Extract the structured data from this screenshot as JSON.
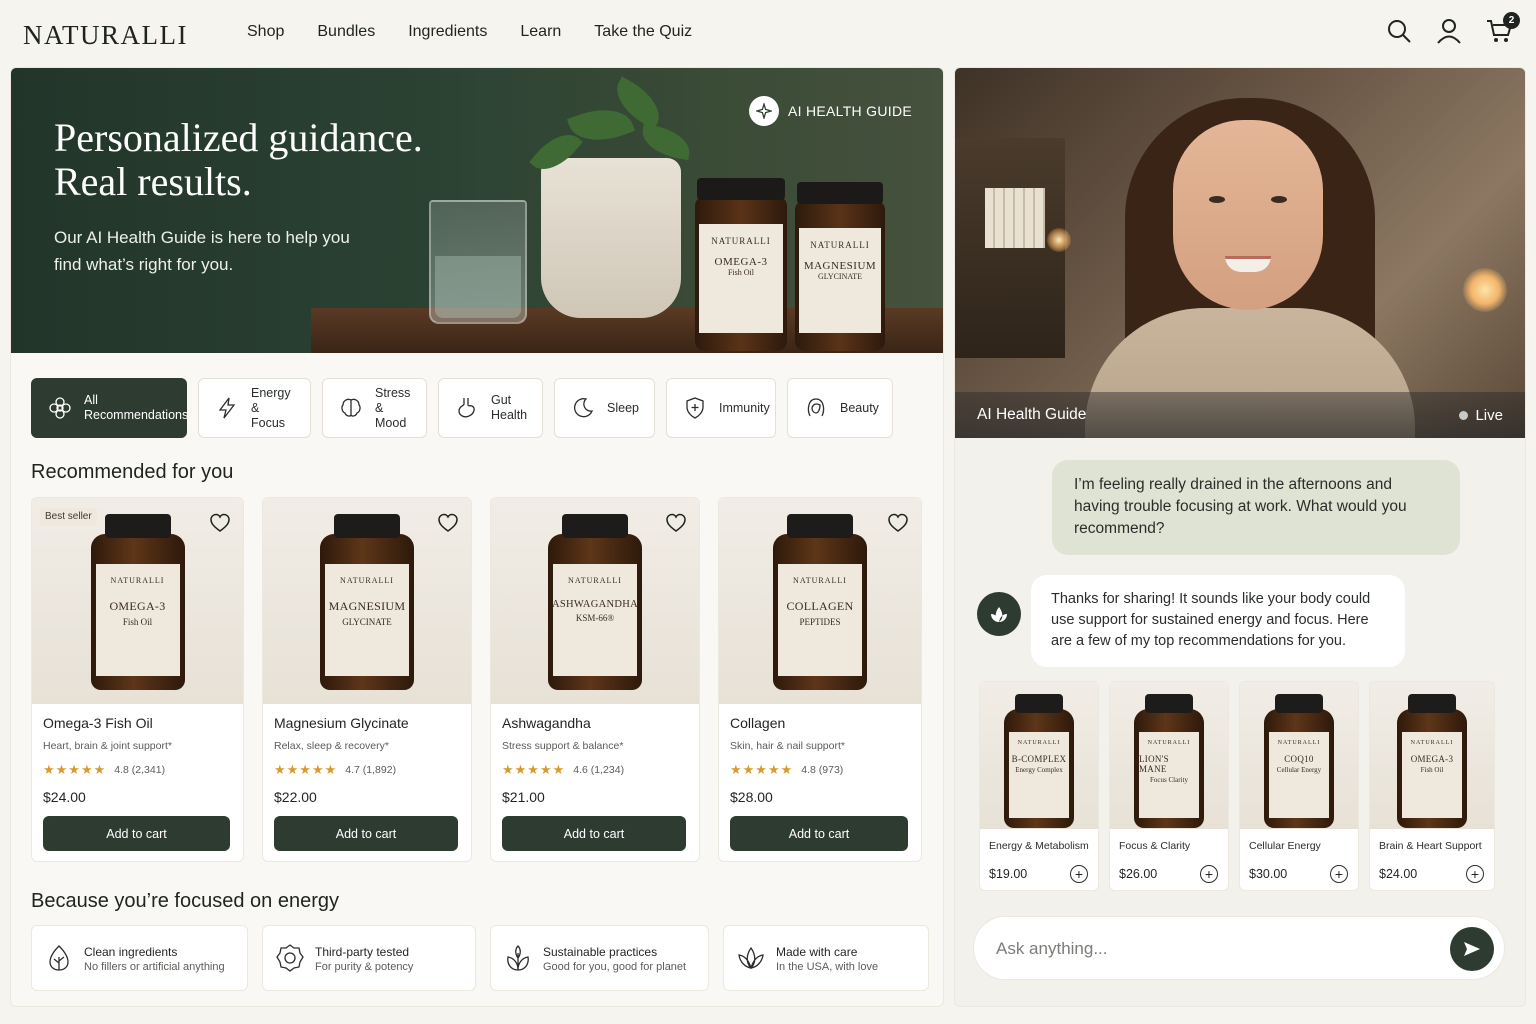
{
  "header": {
    "logo": "NATURALLI",
    "nav": [
      "Shop",
      "Bundles",
      "Ingredients",
      "Learn",
      "Take the Quiz"
    ],
    "cart_count": "2",
    "icons": [
      "search-icon",
      "account-icon",
      "cart-icon"
    ]
  },
  "hero": {
    "title_line1": "Personalized guidance.",
    "title_line2": "Real results.",
    "subtitle": "Our AI Health Guide is here to help you find what’s right for you.",
    "tag": "AI HEALTH GUIDE",
    "jars": [
      {
        "brand": "NATURALLI",
        "name": "OMEGA-3",
        "sub": "Fish Oil"
      },
      {
        "brand": "NATURALLI",
        "name": "MAGNESIUM",
        "sub": "GLYCINATE"
      }
    ]
  },
  "categories": [
    {
      "label1": "All",
      "label2": "Recommendations",
      "icon": "sparkle-icon",
      "active": true
    },
    {
      "label1": "Energy",
      "label2": "& Focus",
      "icon": "lightning-icon",
      "active": false
    },
    {
      "label1": "Stress",
      "label2": "& Mood",
      "icon": "brain-icon",
      "active": false
    },
    {
      "label1": "Gut",
      "label2": "Health",
      "icon": "stomach-icon",
      "active": false
    },
    {
      "label1": "Sleep",
      "label2": "",
      "icon": "moon-icon",
      "active": false
    },
    {
      "label1": "Immunity",
      "label2": "",
      "icon": "shield-icon",
      "active": false
    },
    {
      "label1": "Beauty",
      "label2": "",
      "icon": "face-icon",
      "active": false
    }
  ],
  "recommended": {
    "title": "Recommended for you",
    "products": [
      {
        "badge": "Best seller",
        "brand": "NATURALLI",
        "label_name": "OMEGA-3",
        "label_sub": "Fish Oil",
        "name": "Omega-3 Fish Oil",
        "desc": "Heart, brain & joint support*",
        "stars": "★★★★★",
        "rating": "4.8 (2,341)",
        "price": "$24.00",
        "cta": "Add to cart"
      },
      {
        "badge": "",
        "brand": "NATURALLI",
        "label_name": "MAGNESIUM",
        "label_sub": "GLYCINATE",
        "name": "Magnesium Glycinate",
        "desc": "Relax, sleep & recovery*",
        "stars": "★★★★★",
        "rating": "4.7 (1,892)",
        "price": "$22.00",
        "cta": "Add to cart"
      },
      {
        "badge": "",
        "brand": "NATURALLI",
        "label_name": "ASHWAGANDHA",
        "label_sub": "KSM-66®",
        "name": "Ashwagandha",
        "desc": "Stress support & balance*",
        "stars": "★★★★★",
        "rating": "4.6 (1,234)",
        "price": "$21.00",
        "cta": "Add to cart"
      },
      {
        "badge": "",
        "brand": "NATURALLI",
        "label_name": "COLLAGEN",
        "label_sub": "PEPTIDES",
        "name": "Collagen",
        "desc": "Skin, hair & nail support*",
        "stars": "★★★★★",
        "rating": "4.8 (973)",
        "price": "$28.00",
        "cta": "Add to cart"
      }
    ]
  },
  "energy_section": {
    "title": "Because you’re focused on energy",
    "features": [
      {
        "title": "Clean ingredients",
        "sub": "No fillers or artificial anything",
        "icon": "leaf-drop-icon"
      },
      {
        "title": "Third-party tested",
        "sub": "For purity & potency",
        "icon": "certified-badge-icon"
      },
      {
        "title": "Sustainable practices",
        "sub": "Good for you, good for planet",
        "icon": "plant-icon"
      },
      {
        "title": "Made with care",
        "sub": "In the USA, with love",
        "icon": "lotus-icon"
      }
    ]
  },
  "guide": {
    "video_title": "AI Health Guide",
    "status": "Live",
    "user_message": "I’m feeling really drained in the afternoons and having trouble focusing at work. What would you recommend?",
    "ai_message": "Thanks for sharing! It sounds like your body could use support for sustained energy and focus. Here are a few of my top recommendations for you.",
    "suggestions": [
      {
        "brand": "NATURALLI",
        "label_name": "B-COMPLEX",
        "label_sub": "Energy Complex",
        "name": "Energy & Metabolism",
        "price": "$19.00"
      },
      {
        "brand": "NATURALLI",
        "label_name": "LION'S MANE",
        "label_sub": "Focus Clarity",
        "name": "Focus & Clarity",
        "price": "$26.00"
      },
      {
        "brand": "NATURALLI",
        "label_name": "COQ10",
        "label_sub": "Cellular Energy",
        "name": "Cellular Energy",
        "price": "$30.00"
      },
      {
        "brand": "NATURALLI",
        "label_name": "OMEGA-3",
        "label_sub": "Fish Oil",
        "name": "Brain & Heart Support",
        "price": "$24.00"
      }
    ],
    "input_placeholder": "Ask anything..."
  },
  "colors": {
    "accent": "#2e3b31",
    "background": "#f6f4ef",
    "user_bubble": "#dfe3d4",
    "star": "#d99a2b"
  }
}
